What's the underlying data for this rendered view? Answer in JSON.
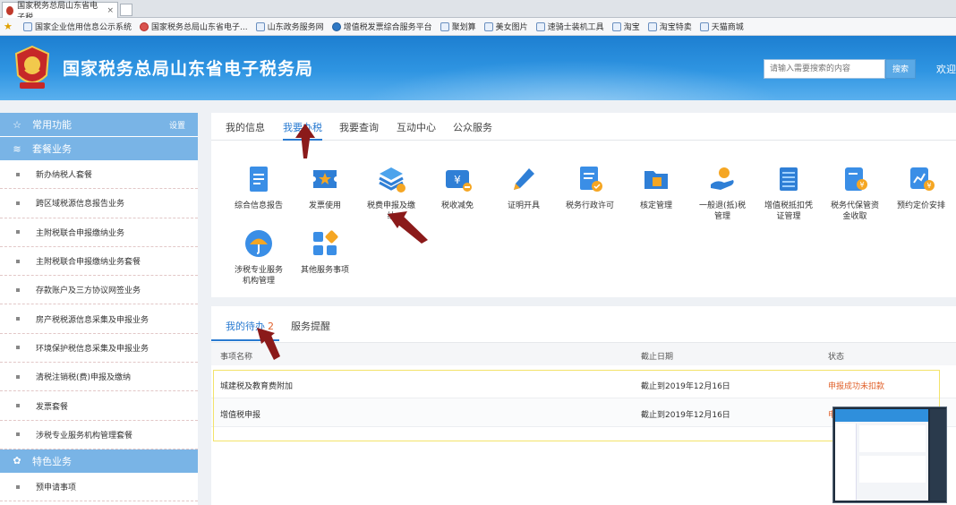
{
  "browser": {
    "tab_title": "国家税务总局山东省电子税...",
    "tab_close": "×"
  },
  "favorites": [
    "国家企业信用信息公示系统",
    "国家税务总局山东省电子...",
    "山东政务服务网",
    "增值税发票综合服务平台",
    "聚划算",
    "美女图片",
    "速骑士装机工具",
    "淘宝",
    "淘宝特卖",
    "天猫商城"
  ],
  "header": {
    "title": "国家税务总局山东省电子税务局",
    "search_placeholder": "请输入需要搜索的内容",
    "search_button": "搜索",
    "welcome": "欢迎"
  },
  "sidebar": {
    "common_label": "常用功能",
    "settings_label": "设置",
    "package_label": "套餐业务",
    "items": [
      "新办纳税人套餐",
      "跨区域税源信息报告业务",
      "主附税联合申报缴纳业务",
      "主附税联合申报缴纳业务套餐",
      "存款账户及三方协议网签业务",
      "房产税税源信息采集及申报业务",
      "环境保护税信息采集及申报业务",
      "清税注销税(费)申报及缴纳",
      "发票套餐",
      "涉税专业服务机构管理套餐"
    ],
    "special_label": "特色业务",
    "special_items": [
      "预申请事项"
    ]
  },
  "nav": {
    "tabs": [
      "我的信息",
      "我要办税",
      "我要查询",
      "互动中心",
      "公众服务"
    ]
  },
  "functions": [
    "综合信息报告",
    "发票使用",
    "税费申报及缴纳",
    "税收减免",
    "证明开具",
    "税务行政许可",
    "核定管理",
    "一般退(抵)税管理",
    "增值税抵扣凭证管理",
    "税务代保管资金收取",
    "预约定价安排",
    "涉税专业服务机构管理",
    "其他服务事项"
  ],
  "tasks": {
    "tab_label": "我的待办",
    "count": "2",
    "reminder_label": "服务提醒",
    "headers": [
      "事项名称",
      "截止日期",
      "状态"
    ],
    "rows": [
      {
        "name": "城建税及教育费附加",
        "deadline": "截止到2019年12月16日",
        "status": "申报成功未扣款"
      },
      {
        "name": "增值税申报",
        "deadline": "截止到2019年12月16日",
        "status": "申"
      }
    ]
  },
  "colors": {
    "header_blue": "#1d7fd1",
    "sidebar_head": "#79b4e6",
    "active_tab": "#2a7bd1",
    "status_orange": "#e0602a",
    "annotation_arrow": "#8b1a1a"
  }
}
